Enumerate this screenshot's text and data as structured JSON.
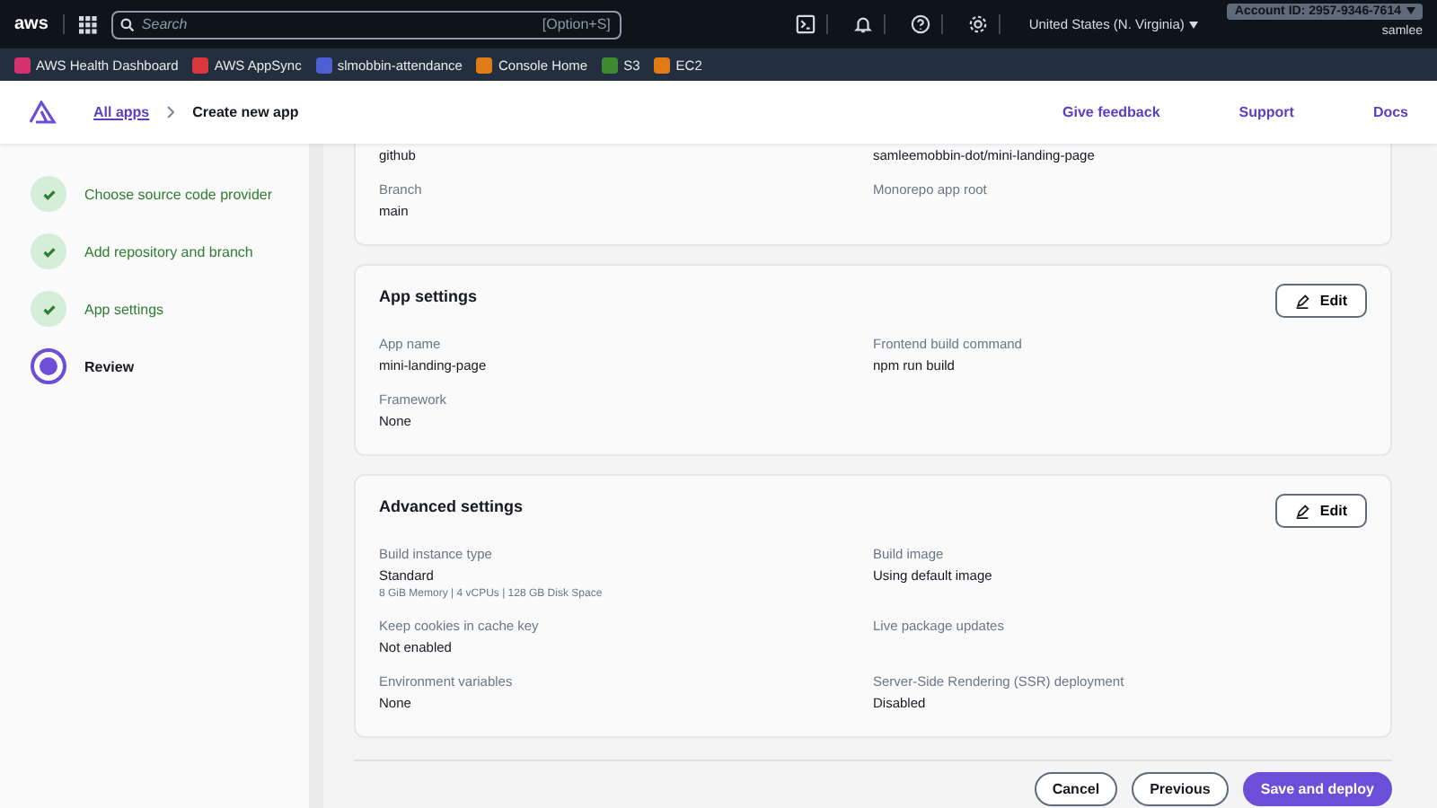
{
  "top_bar": {
    "logo": "aws",
    "search": {
      "placeholder": "Search",
      "shortcut": "[Option+S]"
    },
    "region": "United States (N. Virginia)",
    "account": "Account ID: 2957-9346-7614",
    "user": "samlee"
  },
  "bookmarks": [
    {
      "label": "AWS Health Dashboard",
      "color": "#d6336c"
    },
    {
      "label": "AWS AppSync",
      "color": "#d9363e"
    },
    {
      "label": "slmobbin-attendance",
      "color": "#4c5fd5"
    },
    {
      "label": "Console Home",
      "color": "#e07b16"
    },
    {
      "label": "S3",
      "color": "#3f8c2e"
    },
    {
      "label": "EC2",
      "color": "#e07b16"
    }
  ],
  "header": {
    "breadcrumb": [
      {
        "label": "All apps",
        "kind": "link"
      },
      {
        "label": "Create new app",
        "kind": "current"
      }
    ],
    "links": [
      "Give feedback",
      "Support",
      "Docs"
    ]
  },
  "steps": [
    {
      "label": "Choose source code provider",
      "kind": "done"
    },
    {
      "label": "Add repository and branch",
      "kind": "done"
    },
    {
      "label": "App settings",
      "kind": "done"
    },
    {
      "label": "Review",
      "kind": "current"
    }
  ],
  "sections": [
    {
      "fields": [
        {
          "value": "github"
        },
        {
          "value": "samleemobbin-dot/mini-landing-page"
        },
        {
          "label": "Branch",
          "value": "main"
        },
        {
          "label": "Monorepo app root"
        }
      ]
    },
    {
      "title": "App settings",
      "edit": "Edit",
      "fields": [
        {
          "label": "App name",
          "value": "mini-landing-page"
        },
        {
          "label": "Frontend build command",
          "value": "npm run build"
        },
        {
          "label": "Framework",
          "value": "None"
        }
      ]
    },
    {
      "title": "Advanced settings",
      "edit": "Edit",
      "fields": [
        {
          "label": "Build instance type",
          "value": "Standard",
          "note": "8 GiB Memory | 4 vCPUs | 128 GB Disk Space"
        },
        {
          "label": "Build image",
          "value": "Using default image"
        },
        {
          "label": "Keep cookies in cache key",
          "value": "Not enabled"
        },
        {
          "label": "Live package updates"
        },
        {
          "label": "Environment variables",
          "value": "None"
        },
        {
          "label": "Server-Side Rendering (SSR) deployment",
          "value": "Disabled"
        }
      ]
    }
  ],
  "actions": [
    {
      "label": "Cancel",
      "kind": "secondary"
    },
    {
      "label": "Previous",
      "kind": "secondary"
    },
    {
      "label": "Save and deploy",
      "kind": "primary"
    }
  ]
}
